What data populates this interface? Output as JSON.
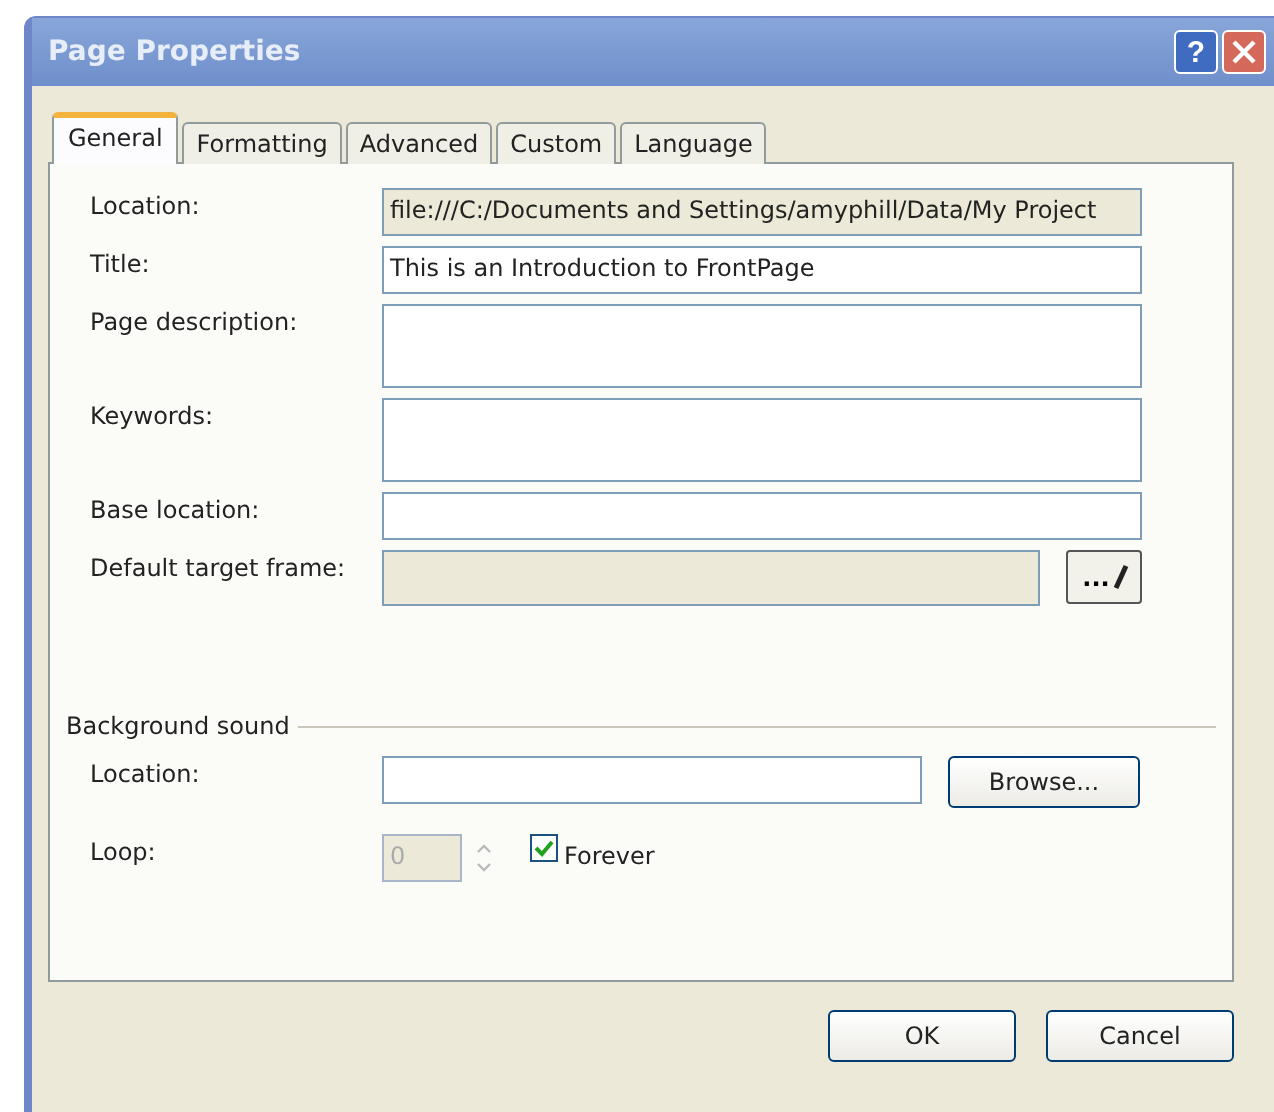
{
  "window": {
    "title": "Page Properties",
    "help": "?"
  },
  "tabs": [
    {
      "label": "General",
      "selected": true
    },
    {
      "label": "Formatting",
      "selected": false
    },
    {
      "label": "Advanced",
      "selected": false
    },
    {
      "label": "Custom",
      "selected": false
    },
    {
      "label": "Language",
      "selected": false
    }
  ],
  "fields": [
    {
      "label": "Location:",
      "kind": "readonly",
      "value": "file:///C:/Documents and Settings/amyphill/Data/My Project"
    },
    {
      "label": "Title:",
      "kind": "text",
      "value": "This is an Introduction to FrontPage"
    },
    {
      "label": "Page description:",
      "kind": "multiline"
    },
    {
      "label": "Keywords:",
      "kind": "multiline"
    },
    {
      "label": "Base location:",
      "kind": "text"
    },
    {
      "label": "Default target frame:",
      "kind": "picker",
      "button": "..."
    }
  ],
  "background_sound": {
    "heading": "Background sound",
    "location_label": "Location:",
    "browse": "Browse...",
    "loop_label": "Loop:",
    "loop_value": "0",
    "loop_disabled": true,
    "forever": {
      "label": "Forever",
      "checked": true
    }
  },
  "buttons": [
    "OK",
    "Cancel"
  ]
}
